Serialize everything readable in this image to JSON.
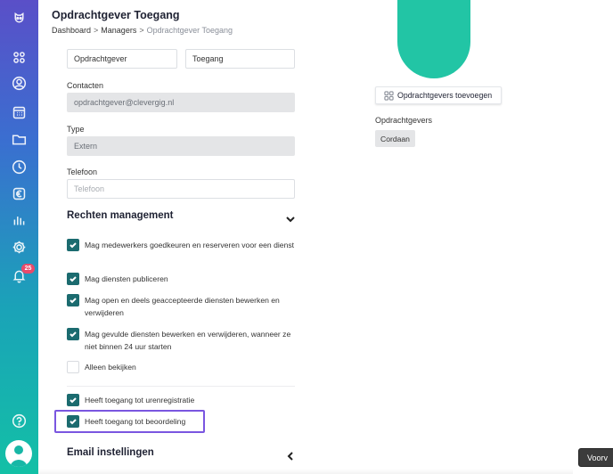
{
  "header": {
    "title": "Opdrachtgever Toegang",
    "breadcrumb": [
      "Dashboard",
      "Managers",
      "Opdrachtgever Toegang"
    ]
  },
  "sidebar": {
    "items": [
      {
        "icon": "logo-icon"
      },
      {
        "icon": "dashboard-icon"
      },
      {
        "icon": "user-icon"
      },
      {
        "icon": "calendar-icon"
      },
      {
        "icon": "folder-icon"
      },
      {
        "icon": "clock-icon"
      },
      {
        "icon": "euro-icon"
      },
      {
        "icon": "bar-chart-icon"
      },
      {
        "icon": "gear-icon"
      },
      {
        "icon": "bell-icon"
      }
    ],
    "notification_count": "25",
    "help_icon": "help-icon"
  },
  "form": {
    "first_name": "Opdrachtgever",
    "last_name": "Toegang",
    "contacts_label": "Contacten",
    "contacts_value": "opdrachtgever@clevergig.nl",
    "type_label": "Type",
    "type_value": "Extern",
    "phone_label": "Telefoon",
    "phone_placeholder": "Telefoon"
  },
  "rights": {
    "title": "Rechten management",
    "options": [
      {
        "label": "Mag medewerkers goedkeuren en reserveren voor een dienst",
        "checked": true
      },
      {
        "label": "Mag diensten publiceren",
        "checked": true
      },
      {
        "label": "Mag open en deels geaccepteerde diensten bewerken en verwijderen",
        "checked": true
      },
      {
        "label": "Mag gevulde diensten bewerken en verwijderen, wanneer ze niet binnen 24 uur starten",
        "checked": true
      },
      {
        "label": "Alleen bekijken",
        "checked": false
      },
      {
        "label": "Heeft toegang tot urenregistratie",
        "checked": true
      },
      {
        "label": "Heeft toegang tot beoordeling",
        "checked": true
      }
    ]
  },
  "email": {
    "title": "Email instellingen"
  },
  "right_panel": {
    "add_button": "Opdrachtgevers toevoegen",
    "clients_label": "Opdrachtgevers",
    "clients": [
      "Cordaan"
    ]
  },
  "floating_button": "Voorv",
  "colors": {
    "checkbox": "#1b6b6f",
    "highlight": "#7a56e0",
    "avatar": "#22c5a5",
    "badge": "#e84a6a"
  }
}
